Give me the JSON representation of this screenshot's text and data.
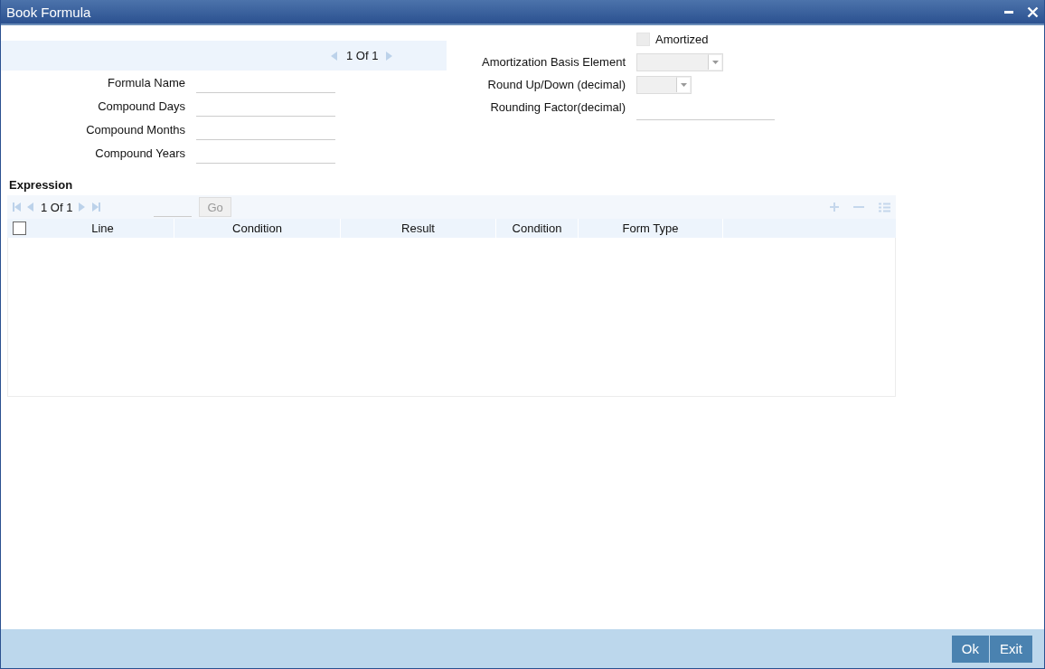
{
  "window": {
    "title": "Book Formula"
  },
  "record_pager": {
    "text": "1 Of 1"
  },
  "fields": [
    {
      "label": "Formula Name"
    },
    {
      "label": "Compound Days"
    },
    {
      "label": "Compound Months"
    },
    {
      "label": "Compound Years"
    }
  ],
  "amortized": {
    "label": "Amortized",
    "checked": false
  },
  "right_fields": [
    {
      "label": "Amortization Basis Element",
      "kind": "select"
    },
    {
      "label": "Round Up/Down (decimal)",
      "kind": "select"
    },
    {
      "label": "Rounding Factor(decimal)",
      "kind": "text"
    }
  ],
  "expression": {
    "title": "Expression",
    "pager": {
      "text": "1 Of 1"
    },
    "go_button": "Go",
    "select_all_checked": false,
    "columns": [
      "Line",
      "Condition",
      "Result",
      "Condition",
      "Form Type"
    ]
  },
  "buttons": [
    "Ok",
    "Exit"
  ]
}
